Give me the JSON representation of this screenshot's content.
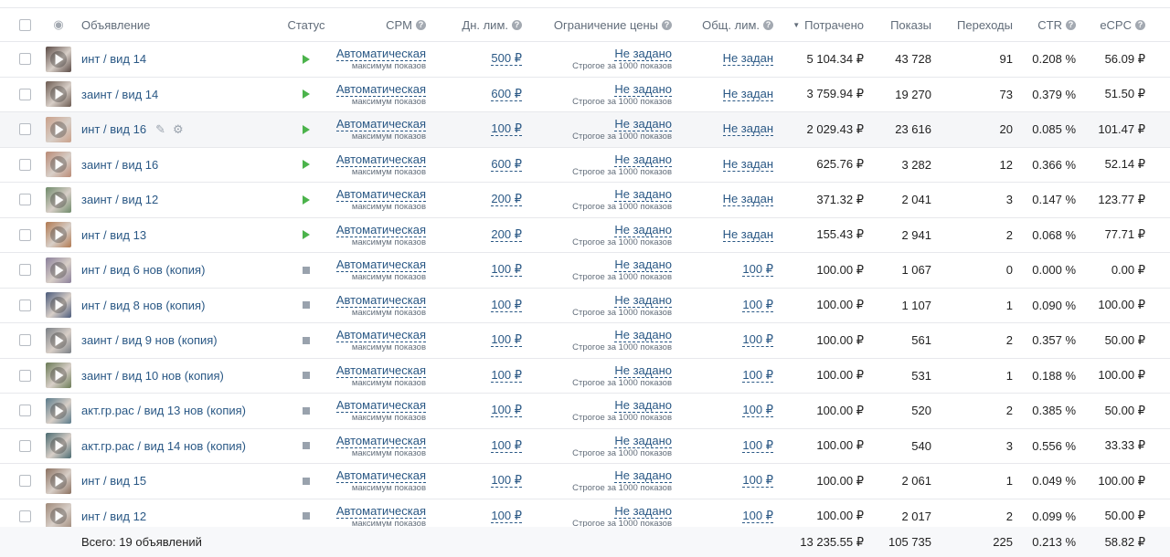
{
  "header": {
    "ad": "Объявление",
    "status": "Статус",
    "cpm": "CPM",
    "daily_limit": "Дн. лим.",
    "price_limit": "Ограничение цены",
    "total_limit": "Общ. лим.",
    "spent": "Потрачено",
    "shows": "Показы",
    "clicks": "Переходы",
    "ctr": "CTR",
    "ecpc": "eCPC"
  },
  "icons": {
    "eye": "eye-icon",
    "help": "question-circle-icon",
    "sort": "sort-desc-icon",
    "edit": "pencil-icon",
    "settings": "gear-icon",
    "play": "play-status-icon",
    "stop": "stopped-status-icon"
  },
  "colors": {
    "link": "#2a5885",
    "active": "#4bb34b",
    "stopped": "#99a2ad"
  },
  "common": {
    "cpm_value": "Автоматическая",
    "cpm_sub": "максимум показов",
    "price_value": "Не задано",
    "price_sub": "Строгое за 1000 показов"
  },
  "rows": [
    {
      "name": "инт / вид 14",
      "status": "active",
      "daily": "500 ₽",
      "total": "Не задан",
      "spent": "5 104.34 ₽",
      "shows": "43 728",
      "clicks": "91",
      "ctr": "0.208 %",
      "ecpc": "56.09 ₽",
      "thumb": "#5a4a45"
    },
    {
      "name": "заинт / вид 14",
      "status": "active",
      "daily": "600 ₽",
      "total": "Не задан",
      "spent": "3 759.94 ₽",
      "shows": "19 270",
      "clicks": "73",
      "ctr": "0.379 %",
      "ecpc": "51.50 ₽",
      "thumb": "#6b5a50"
    },
    {
      "name": "инт / вид 16",
      "status": "active",
      "daily": "100 ₽",
      "total": "Не задан",
      "spent": "2 029.43 ₽",
      "shows": "23 616",
      "clicks": "20",
      "ctr": "0.085 %",
      "ecpc": "101.47 ₽",
      "thumb": "#c9a08a"
    },
    {
      "name": "заинт / вид 16",
      "status": "active",
      "daily": "600 ₽",
      "total": "Не задан",
      "spent": "625.76 ₽",
      "shows": "3 282",
      "clicks": "12",
      "ctr": "0.366 %",
      "ecpc": "52.14 ₽",
      "thumb": "#b98a75"
    },
    {
      "name": "заинт / вид 12",
      "status": "active",
      "daily": "200 ₽",
      "total": "Не задан",
      "spent": "371.32 ₽",
      "shows": "2 041",
      "clicks": "3",
      "ctr": "0.147 %",
      "ecpc": "123.77 ₽",
      "thumb": "#6f8a6a"
    },
    {
      "name": "инт / вид 13",
      "status": "active",
      "daily": "200 ₽",
      "total": "Не задан",
      "spent": "155.43 ₽",
      "shows": "2 941",
      "clicks": "2",
      "ctr": "0.068 %",
      "ecpc": "77.71 ₽",
      "thumb": "#b07850"
    },
    {
      "name": "инт / вид 6 нов (копия)",
      "status": "stopped",
      "daily": "100 ₽",
      "total": "100 ₽",
      "spent": "100.00 ₽",
      "shows": "1 067",
      "clicks": "0",
      "ctr": "0.000 %",
      "ecpc": "0.00 ₽",
      "thumb": "#8a7f9a"
    },
    {
      "name": "инт / вид 8 нов (копия)",
      "status": "stopped",
      "daily": "100 ₽",
      "total": "100 ₽",
      "spent": "100.00 ₽",
      "shows": "1 107",
      "clicks": "1",
      "ctr": "0.090 %",
      "ecpc": "100.00 ₽",
      "thumb": "#4a5a7a"
    },
    {
      "name": "заинт / вид 9 нов (копия)",
      "status": "stopped",
      "daily": "100 ₽",
      "total": "100 ₽",
      "spent": "100.00 ₽",
      "shows": "561",
      "clicks": "2",
      "ctr": "0.357 %",
      "ecpc": "50.00 ₽",
      "thumb": "#7a7f85"
    },
    {
      "name": "заинт / вид 10 нов (копия)",
      "status": "stopped",
      "daily": "100 ₽",
      "total": "100 ₽",
      "spent": "100.00 ₽",
      "shows": "531",
      "clicks": "1",
      "ctr": "0.188 %",
      "ecpc": "100.00 ₽",
      "thumb": "#6a7a55"
    },
    {
      "name": "акт.гр.рас / вид 13 нов (копия)",
      "status": "stopped",
      "daily": "100 ₽",
      "total": "100 ₽",
      "spent": "100.00 ₽",
      "shows": "520",
      "clicks": "2",
      "ctr": "0.385 %",
      "ecpc": "50.00 ₽",
      "thumb": "#5a7a8a"
    },
    {
      "name": "акт.гр.рас / вид 14 нов (копия)",
      "status": "stopped",
      "daily": "100 ₽",
      "total": "100 ₽",
      "spent": "100.00 ₽",
      "shows": "540",
      "clicks": "3",
      "ctr": "0.556 %",
      "ecpc": "33.33 ₽",
      "thumb": "#4a6a70"
    },
    {
      "name": "инт / вид 15",
      "status": "stopped",
      "daily": "100 ₽",
      "total": "100 ₽",
      "spent": "100.00 ₽",
      "shows": "2 061",
      "clicks": "1",
      "ctr": "0.049 %",
      "ecpc": "100.00 ₽",
      "thumb": "#8a7060"
    },
    {
      "name": "инт / вид 12",
      "status": "stopped",
      "daily": "100 ₽",
      "total": "100 ₽",
      "spent": "100.00 ₽",
      "shows": "2 017",
      "clicks": "2",
      "ctr": "0.099 %",
      "ecpc": "50.00 ₽",
      "thumb": "#a08a7a"
    }
  ],
  "footer": {
    "label": "Всего: 19 объявлений",
    "spent": "13 235.55 ₽",
    "shows": "105 735",
    "clicks": "225",
    "ctr": "0.213 %",
    "ecpc": "58.82 ₽"
  }
}
